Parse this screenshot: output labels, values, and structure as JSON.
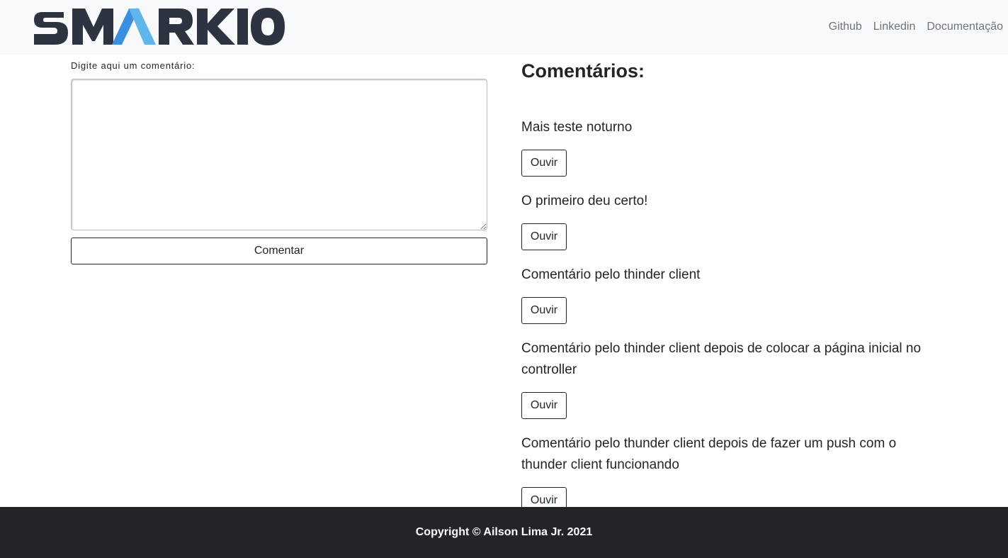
{
  "navbar": {
    "logo_text": "SMARKIO",
    "links": [
      "Github",
      "Linkedin",
      "Documentação"
    ]
  },
  "form": {
    "label": "Digite aqui um comentário:",
    "textarea_value": "",
    "submit_label": "Comentar"
  },
  "comments_section": {
    "title": "Comentários:",
    "listen_label": "Ouvir",
    "items": [
      "Mais teste noturno",
      "O primeiro deu certo!",
      "Comentário pelo thinder client",
      "Comentário pelo thinder client depois de colocar a página inicial no controller",
      "Comentário pelo thunder client depois de fazer um push com o thunder client funcionando"
    ]
  },
  "footer": {
    "copyright": "Copyright © Ailson Lima Jr. 2021"
  },
  "colors": {
    "logo_dark": "#2e3342",
    "logo_blue": "#3b8fe0",
    "logo_light_blue": "#5fb6ea",
    "footer_bg": "#212529",
    "navbar_bg": "#f8f9fa"
  }
}
